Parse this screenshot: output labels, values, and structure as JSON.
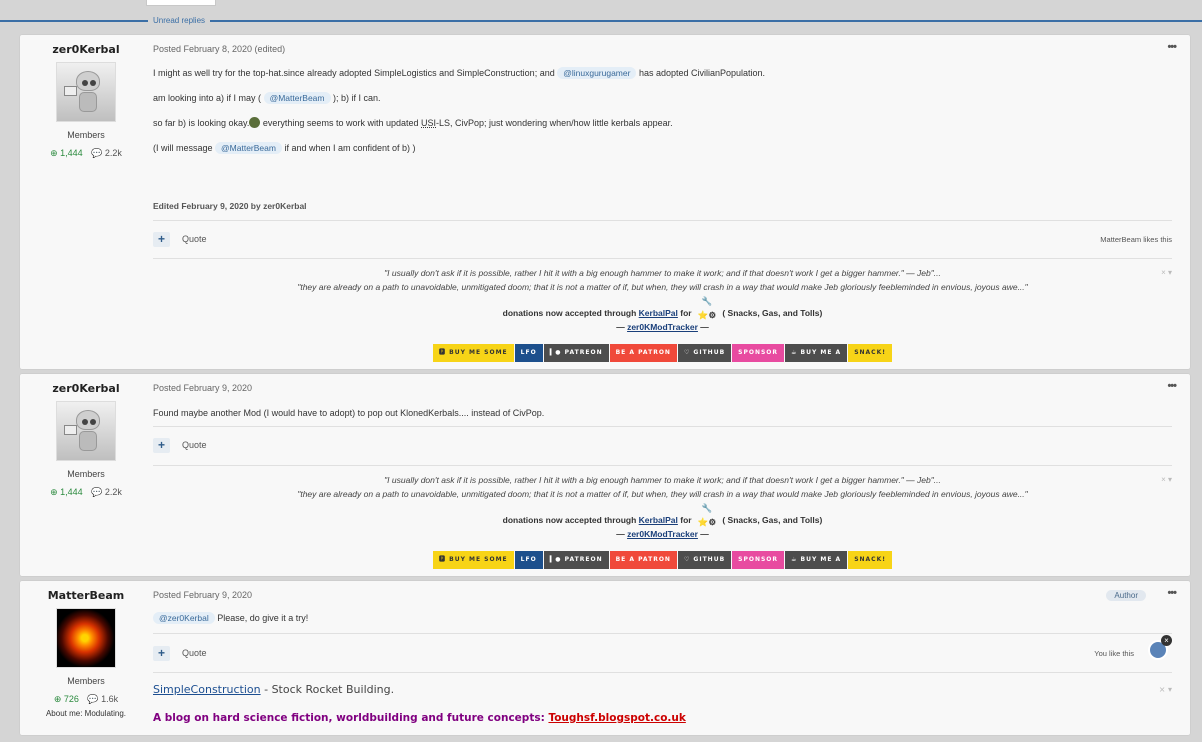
{
  "unread_label": "Unread replies",
  "posts": [
    {
      "author": "zer0Kerbal",
      "role": "Members",
      "reputation": "1,444",
      "post_count": "2.2k",
      "meta": "Posted February 8, 2020 (edited)",
      "more": "•••",
      "body": {
        "p1_a": "I might as well try for the top-hat.since already adopted SimpleLogistics and SimpleConstruction; and",
        "p1_mention": "@linuxgurugamer",
        "p1_b": "has adopted CivilianPopulation.",
        "p2_a": "am looking into a) if I may (",
        "p2_mention": "@MatterBeam",
        "p2_b": "); b) if I can.",
        "p3_a": "so far b) is looking okay.",
        "p3_b": "everything seems to work with updated",
        "p3_usi": "USI",
        "p3_c": "-LS, CivPop; just wondering when/how little kerbals appear.",
        "p4_a": "(I will message",
        "p4_mention": "@MatterBeam",
        "p4_b": "if and when I am confident of b) )"
      },
      "edited": "Edited February 9, 2020 by zer0Kerbal",
      "quote": "Quote",
      "likes": "MatterBeam likes this"
    },
    {
      "author": "zer0Kerbal",
      "role": "Members",
      "reputation": "1,444",
      "post_count": "2.2k",
      "meta": "Posted February 9, 2020",
      "more": "•••",
      "body": "Found maybe another Mod (I would have to adopt) to pop out KlonedKerbals.... instead of CivPop.",
      "quote": "Quote"
    },
    {
      "author": "MatterBeam",
      "role": "Members",
      "reputation": "726",
      "post_count": "1.6k",
      "about_label": "About me:",
      "about_value": "Modulating.",
      "meta": "Posted February 9, 2020",
      "author_badge": "Author",
      "more": "•••",
      "mention": "@zer0Kerbal",
      "body": "Please, do give it a try!",
      "quote": "Quote",
      "likes": "You like this",
      "sig_link": "SimpleConstruction",
      "sig_desc": " - Stock Rocket Building.",
      "blog_text": "A blog on hard science fiction, worldbuilding and future concepts:",
      "blog_link": "Toughsf.blogspot.co.uk"
    }
  ],
  "signature": {
    "quote1": "\"I usually don't ask if it is possible, rather I hit it with a big enough hammer to make it work; and if that doesn't work I get a bigger hammer.\"  — Jeb\"...",
    "quote2": "\"they are already on a path to unavoidable, unmitigated doom; that it is not a matter of if, but when, they will crash in a way that would make Jeb gloriously feebleminded in envious, joyous awe...\"",
    "donate_a": "donations now accepted through",
    "donate_link": "KerbalPal",
    "donate_b": "for",
    "donate_c": "( Snacks, Gas, and Tolls)",
    "tracker_dash_l": "— ",
    "tracker_link": "zer0KModTracker",
    "tracker_dash_r": " —",
    "close": "× ▾",
    "badges": [
      {
        "text": "🅿 Buy me some",
        "bg": "#f7d417",
        "fg": "#333"
      },
      {
        "text": "LFO",
        "bg": "#1c4f8c",
        "fg": "#fff"
      },
      {
        "text": "▍● Patreon",
        "bg": "#4d4d4d",
        "fg": "#fff"
      },
      {
        "text": "Be a patron",
        "bg": "#f0493a",
        "fg": "#fff"
      },
      {
        "text": "♡ Github",
        "bg": "#4d4d4d",
        "fg": "#fff"
      },
      {
        "text": "Sponsor",
        "bg": "#e84ba0",
        "fg": "#fff"
      },
      {
        "text": "☕ Buy me a",
        "bg": "#4d4d4d",
        "fg": "#fff"
      },
      {
        "text": "Snack!",
        "bg": "#f7d417",
        "fg": "#333"
      }
    ]
  }
}
